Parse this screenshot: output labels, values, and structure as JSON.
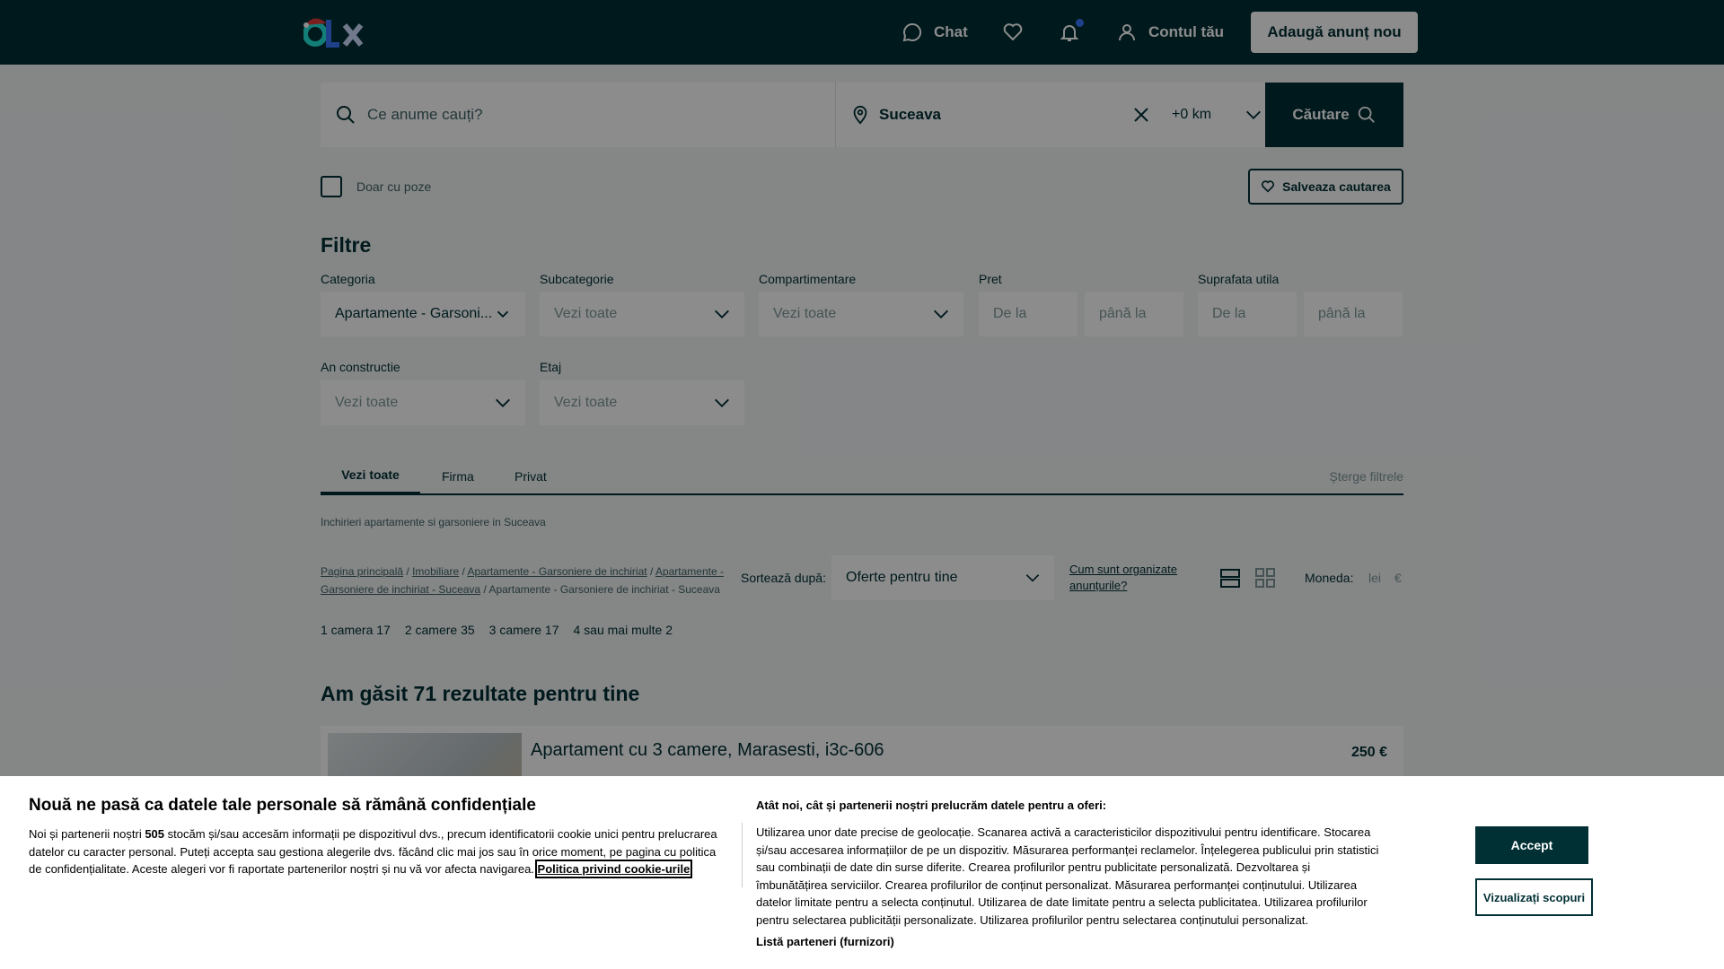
{
  "colors": {
    "brand": "#002f34",
    "accent_dot": "#3a77ff",
    "page_bg": "#f2f4f5"
  },
  "header": {
    "logo": "olx-logo",
    "chat_label": "Chat",
    "account_label": "Contul tău",
    "add_button": "Adaugă anunț nou"
  },
  "search": {
    "query_placeholder": "Ce anume cauți?",
    "location_value": "Suceava",
    "radius_value": "+0 km",
    "button_label": "Căutare"
  },
  "photo_only": {
    "label": "Doar cu poze",
    "checked": false
  },
  "save_search_label": "Salveaza cautarea",
  "filters": {
    "title": "Filtre",
    "category": {
      "label": "Categoria",
      "value": "Apartamente - Garsoni..."
    },
    "subcategory": {
      "label": "Subcategorie",
      "value": "Vezi toate"
    },
    "compartment": {
      "label": "Compartimentare",
      "value": "Vezi toate"
    },
    "price": {
      "label": "Pret",
      "from": "De la",
      "to": "până la"
    },
    "area": {
      "label": "Suprafata utila",
      "from": "De la",
      "to": "până la"
    },
    "year": {
      "label": "An constructie",
      "value": "Vezi toate"
    },
    "floor": {
      "label": "Etaj",
      "value": "Vezi toate"
    }
  },
  "tabs": {
    "all": "Vezi toate",
    "company": "Firma",
    "private": "Privat",
    "clear": "Șterge filtrele"
  },
  "page_heading": "Inchirieri apartamente si garsoniere in Suceava",
  "breadcrumb": {
    "home": "Pagina principală",
    "real_estate": "Imobiliare",
    "rent": "Apartamente - Garsoniere de inchiriat",
    "rent_suceava": "Apartamente - Garsoniere de inchiriat - Suceava",
    "current": "Apartamente - Garsoniere de inchiriat - Suceava",
    "sep": "/"
  },
  "sort": {
    "label": "Sortează după:",
    "value": "Oferte pentru tine"
  },
  "how_organized": "Cum sunt organizate anunțurile?",
  "currency": {
    "label": "Moneda:",
    "lei": "lei",
    "eur": "€"
  },
  "rooms": [
    "1 camera 17",
    "2 camere 35",
    "3 camere 17",
    "4 sau mai multe 2"
  ],
  "results_title": "Am găsit 71 rezultate pentru tine",
  "listing": {
    "title": "Apartament cu 3 camere, Marasesti, i3c-606",
    "price": "250 €"
  },
  "cookie": {
    "title": "Nouă ne pasă ca datele tale personale să rămână confidențiale",
    "text_a": "Noi și partenerii noștri ",
    "partners_count": "505",
    "text_b": " stocăm și/sau accesăm informații pe dispozitivul dvs., precum identificatorii cookie unici pentru prelucrarea datelor cu caracter personal. Puteți accepta sau gestiona alegerile dvs. făcând clic mai jos sau în orice moment, pe pagina cu politica de confidențialitate. Aceste alegeri vor fi raportate partenerilor noștri și nu vă vor afecta navigarea. ",
    "policy_link": "Politica privind cookie-urile",
    "title2": "Atât noi, cât și partenerii noștri prelucrăm datele pentru a oferi:",
    "purposes": "Utilizarea unor date precise de geolocație. Scanarea activă a caracteristicilor dispozitivului pentru identificare. Stocarea și/sau accesarea informațiilor de pe un dispozitiv. Măsurarea performanței reclamelor. Înțelegerea publicului prin statistici sau combinații de date din surse diferite. Crearea profilurilor pentru publicitate personalizată. Dezvoltarea și îmbunătățirea serviciilor. Crearea profilurilor de conținut personalizat. Măsurarea performanței conținutului. Utilizarea datelor limitate pentru a selecta conținutul. Utilizarea de date limitate pentru a selecta publicitatea. Utilizarea profilurilor pentru selectarea publicității personalizate. Utilizarea profilurilor pentru selectarea conținutului personalizat.",
    "partners_list": "Listă parteneri (furnizori)",
    "accept": "Accept",
    "view_purposes": "Vizualizați scopuri"
  }
}
